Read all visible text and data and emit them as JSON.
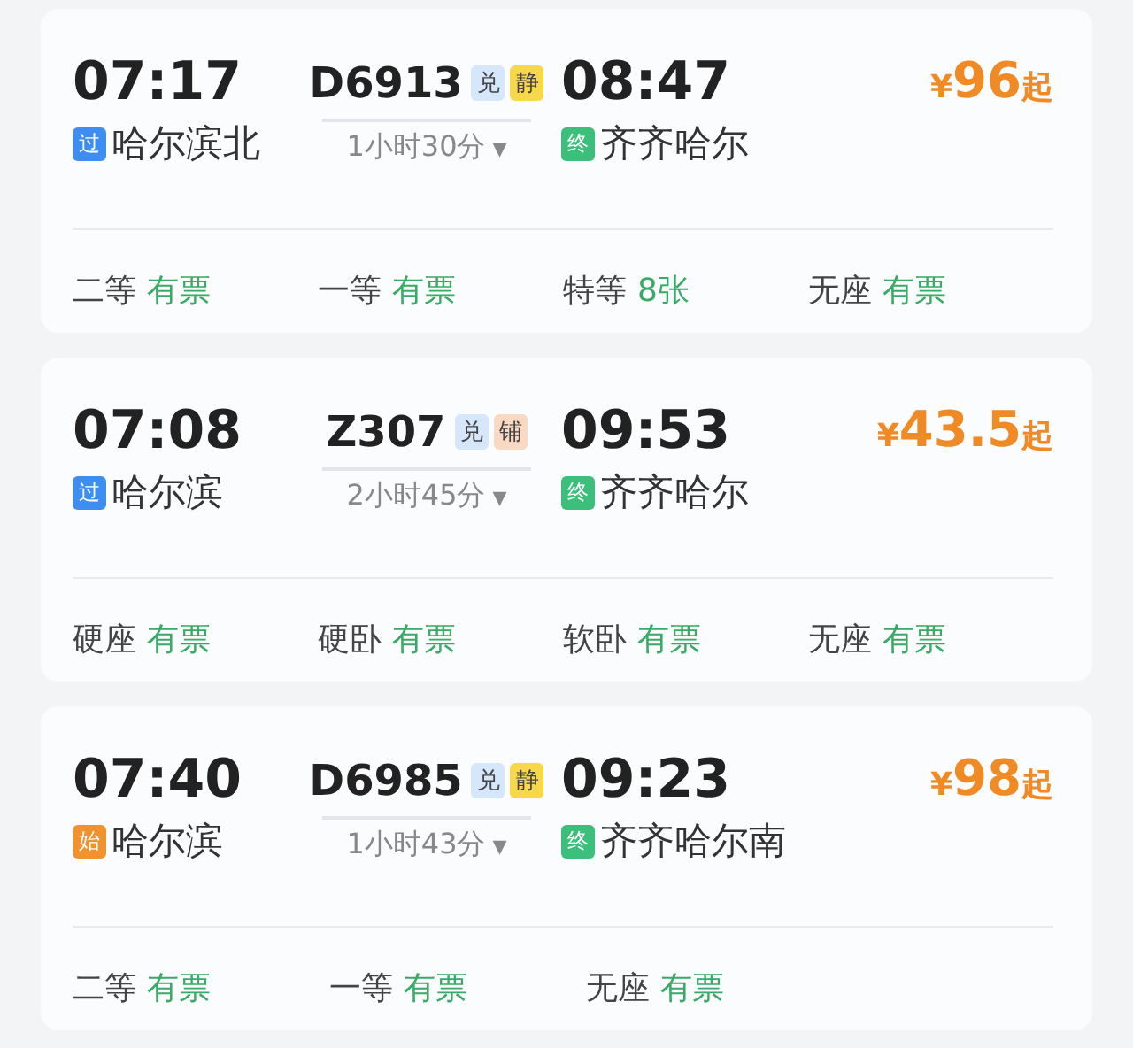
{
  "trains": [
    {
      "depart_time": "07:17",
      "depart_mark": {
        "label": "过",
        "color": "#3d8ef0"
      },
      "depart_station": "哈尔滨北",
      "train_no": "D6913",
      "tags": [
        {
          "label": "兑",
          "color": "#d6e6fb"
        },
        {
          "label": "静",
          "color": "#f7d84a"
        }
      ],
      "duration": "1小时30分",
      "dropdown": "▾",
      "arrive_time": "08:47",
      "arrive_mark": {
        "label": "终",
        "color": "#3cbf7a"
      },
      "arrive_station": "齐齐哈尔",
      "price": {
        "currency": "¥",
        "amount": "96",
        "suffix": "起"
      },
      "seats": [
        {
          "class": "二等",
          "availability": "有票"
        },
        {
          "class": "一等",
          "availability": "有票"
        },
        {
          "class": "特等",
          "availability": "8张"
        },
        {
          "class": "无座",
          "availability": "有票"
        }
      ]
    },
    {
      "depart_time": "07:08",
      "depart_mark": {
        "label": "过",
        "color": "#3d8ef0"
      },
      "depart_station": "哈尔滨",
      "train_no": "Z307",
      "tags": [
        {
          "label": "兑",
          "color": "#d6e6fb"
        },
        {
          "label": "铺",
          "color": "#f9d9c4"
        }
      ],
      "duration": "2小时45分",
      "dropdown": "▾",
      "arrive_time": "09:53",
      "arrive_mark": {
        "label": "终",
        "color": "#3cbf7a"
      },
      "arrive_station": "齐齐哈尔",
      "price": {
        "currency": "¥",
        "amount": "43.5",
        "suffix": "起"
      },
      "seats": [
        {
          "class": "硬座",
          "availability": "有票"
        },
        {
          "class": "硬卧",
          "availability": "有票"
        },
        {
          "class": "软卧",
          "availability": "有票"
        },
        {
          "class": "无座",
          "availability": "有票"
        }
      ]
    },
    {
      "depart_time": "07:40",
      "depart_mark": {
        "label": "始",
        "color": "#f0922e"
      },
      "depart_station": "哈尔滨",
      "train_no": "D6985",
      "tags": [
        {
          "label": "兑",
          "color": "#d6e6fb"
        },
        {
          "label": "静",
          "color": "#f7d84a"
        }
      ],
      "duration": "1小时43分",
      "dropdown": "▾",
      "arrive_time": "09:23",
      "arrive_mark": {
        "label": "终",
        "color": "#3cbf7a"
      },
      "arrive_station": "齐齐哈尔南",
      "price": {
        "currency": "¥",
        "amount": "98",
        "suffix": "起"
      },
      "seats": [
        {
          "class": "二等",
          "availability": "有票"
        },
        {
          "class": "一等",
          "availability": "有票"
        },
        {
          "class": "无座",
          "availability": "有票"
        }
      ]
    }
  ]
}
